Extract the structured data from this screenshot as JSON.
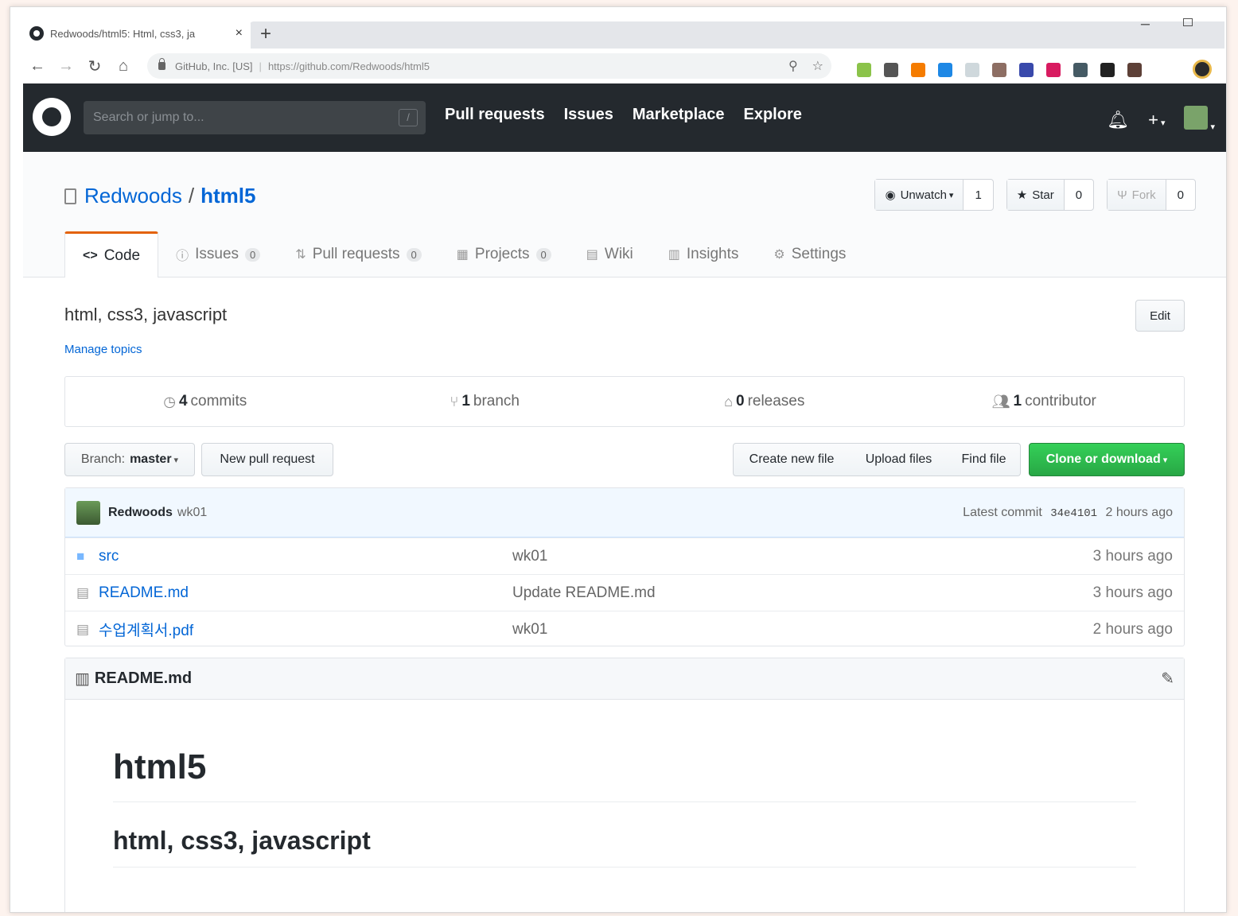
{
  "browser": {
    "tab_title": "Redwoods/html5: Html, css3, ja",
    "close": "×",
    "new_tab": "+",
    "omnibox_org": "GitHub, Inc. [US]",
    "url": "https://github.com/Redwoods/html5",
    "ext_colors": [
      "#8bc34a",
      "#555555",
      "#f57c00",
      "#1e88e5",
      "#cfd8dc",
      "#8d6e63",
      "#3949ab",
      "#d81b60",
      "#455a64",
      "#212121",
      "#5d4037"
    ]
  },
  "github": {
    "search_placeholder": "Search or jump to...",
    "search_key": "/",
    "nav": [
      "Pull requests",
      "Issues",
      "Marketplace",
      "Explore"
    ]
  },
  "repo": {
    "owner": "Redwoods",
    "slash": "/",
    "name": "html5",
    "watch_label": "Unwatch",
    "watch_count": "1",
    "star_label": "Star",
    "star_count": "0",
    "fork_label": "Fork",
    "fork_count": "0",
    "tabs": [
      {
        "label": "Code",
        "icon": "<>"
      },
      {
        "label": "Issues",
        "count": "0",
        "icon": "ⓘ"
      },
      {
        "label": "Pull requests",
        "count": "0",
        "icon": "⇅"
      },
      {
        "label": "Projects",
        "count": "0",
        "icon": "▦"
      },
      {
        "label": "Wiki",
        "icon": "▤"
      },
      {
        "label": "Insights",
        "icon": "▥"
      },
      {
        "label": "Settings",
        "icon": "⚙"
      }
    ]
  },
  "summary": {
    "description": "html, css3, javascript",
    "edit": "Edit",
    "manage_topics": "Manage topics",
    "commits_count": "4",
    "commits_label": "commits",
    "branch_count": "1",
    "branch_label": "branch",
    "releases_count": "0",
    "releases_label": "releases",
    "contributor_count": "1",
    "contributor_label": "contributor"
  },
  "filenav": {
    "branch_prefix": "Branch:",
    "branch_name": "master",
    "new_pr": "New pull request",
    "create": "Create new file",
    "upload": "Upload files",
    "find": "Find file",
    "clone": "Clone or download"
  },
  "commit": {
    "author": "Redwoods",
    "message": "wk01",
    "latest_label": "Latest commit",
    "sha": "34e4101",
    "age": "2 hours ago"
  },
  "files": [
    {
      "name": "src",
      "message": "wk01",
      "age": "3 hours ago",
      "type": "dir"
    },
    {
      "name": "README.md",
      "message": "Update README.md",
      "age": "3 hours ago",
      "type": "file"
    },
    {
      "name": "수업계획서.pdf",
      "message": "wk01",
      "age": "2 hours ago",
      "type": "file"
    }
  ],
  "readme": {
    "filename": "README.md",
    "h1": "html5",
    "h2": "html, css3, javascript"
  }
}
